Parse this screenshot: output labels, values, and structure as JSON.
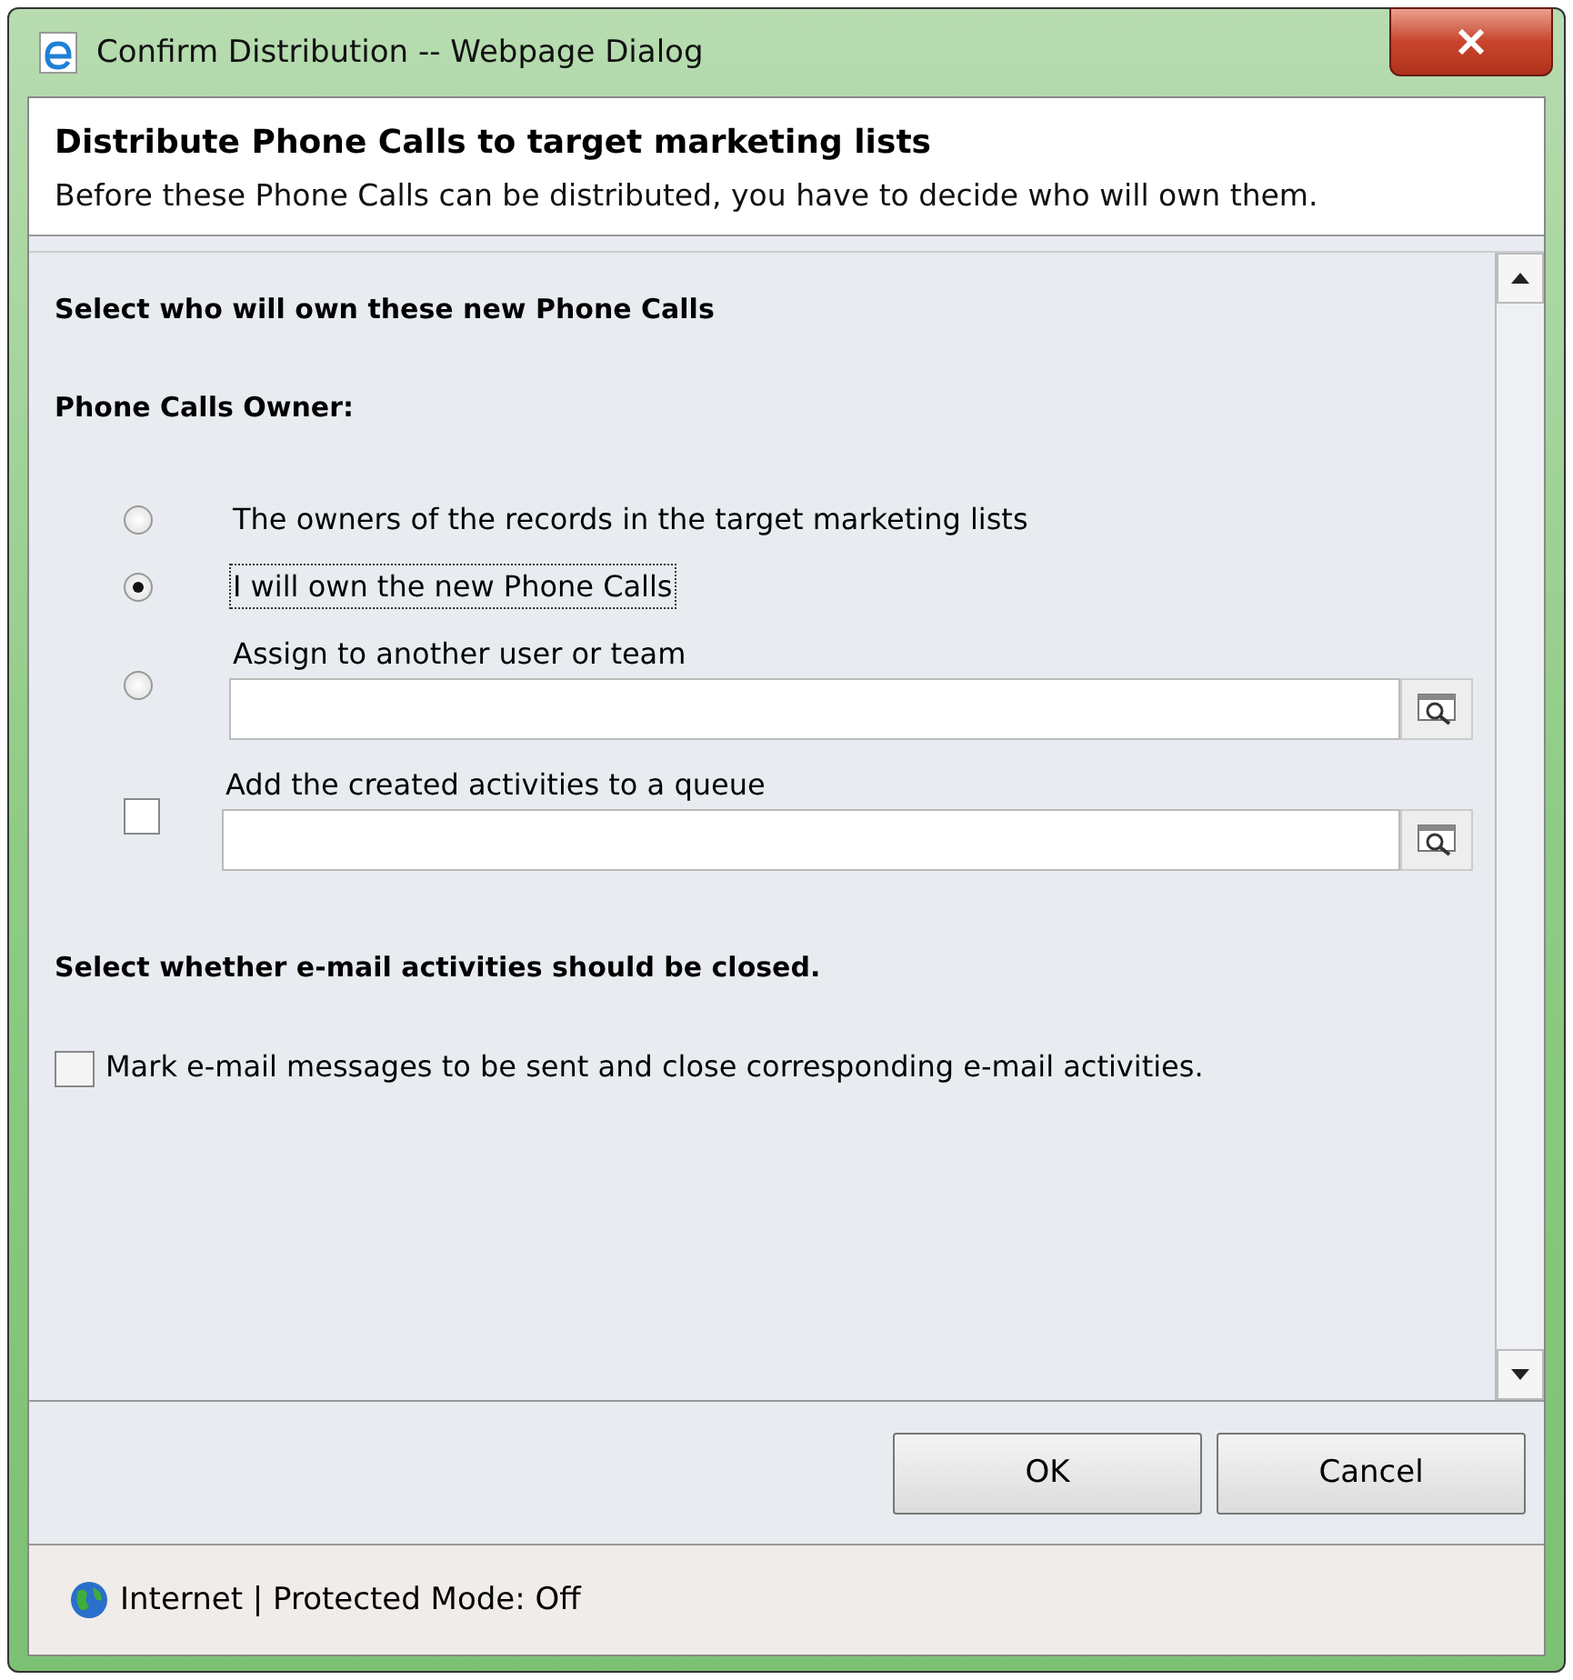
{
  "window": {
    "title": "Confirm Distribution -- Webpage Dialog"
  },
  "header": {
    "title": "Distribute Phone Calls to target marketing lists",
    "description": "Before these Phone Calls can be distributed, you have to decide who will own them."
  },
  "owner_section": {
    "heading": "Select who will own these new Phone Calls",
    "label": "Phone Calls Owner:"
  },
  "options": [
    {
      "kind": "radio",
      "label": "The owners of the records in the target marketing lists",
      "selected": false
    },
    {
      "kind": "radio",
      "label": "I will own the new Phone Calls",
      "selected": true
    },
    {
      "kind": "radio_lookup",
      "label": "Assign to another user or team",
      "selected": false
    },
    {
      "kind": "checkbox_lookup",
      "label": "Add the created activities to a queue",
      "checked": false
    }
  ],
  "email_section": {
    "heading": "Select whether e-mail activities should be closed.",
    "checkbox": {
      "label": "Mark e-mail messages to be sent and close corresponding e-mail activities.",
      "checked": false
    }
  },
  "buttons": [
    "OK",
    "Cancel"
  ],
  "status_bar": {
    "text": "Internet | Protected Mode: Off"
  }
}
